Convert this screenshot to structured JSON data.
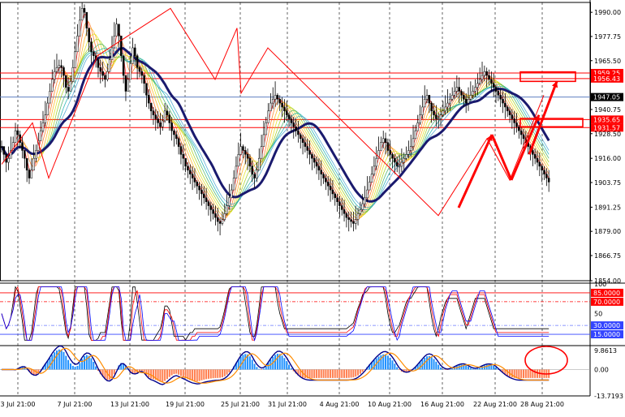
{
  "chart_data": {
    "type": "line",
    "instrument_panels": [
      {
        "panel": "price",
        "series": [
          {
            "role": "price",
            "x": [
              0,
              1,
              2,
              3,
              4,
              5,
              6,
              7,
              8,
              9,
              10,
              11,
              12,
              13,
              14,
              15,
              16,
              17,
              18,
              19,
              20,
              21,
              22,
              23,
              24,
              25,
              26,
              27,
              28,
              29,
              30,
              31,
              32,
              33,
              34,
              35,
              36,
              37,
              38,
              39,
              40,
              41,
              42,
              43,
              44,
              45,
              46,
              47,
              48,
              49,
              50,
              51,
              52,
              53,
              54,
              55,
              56,
              57,
              58,
              59,
              60,
              61,
              62,
              63,
              64,
              65,
              66,
              67,
              68,
              69,
              70,
              71,
              72,
              73,
              74,
              75,
              76,
              77,
              78,
              79,
              80,
              81,
              82,
              83,
              84,
              85,
              86,
              87,
              88,
              89,
              90,
              91,
              92,
              93,
              94,
              95,
              96,
              97,
              98,
              99,
              100,
              101,
              102,
              103,
              104,
              105,
              106,
              107,
              108,
              109,
              110,
              111,
              112,
              113,
              114,
              115,
              116,
              117,
              118,
              119,
              120,
              121,
              122,
              123,
              124,
              125,
              126,
              127,
              128,
              129,
              130,
              131,
              132,
              133,
              134,
              135,
              136,
              137,
              138,
              139,
              140,
              141,
              142,
              143,
              144,
              145,
              146,
              147,
              148,
              149,
              150,
              151,
              152,
              153,
              154,
              155,
              156,
              157,
              158,
              159,
              160,
              161,
              162,
              163,
              164,
              165,
              166,
              167,
              168,
              169,
              170,
              171,
              172,
              173,
              174,
              175,
              176,
              177,
              178,
              179,
              180,
              181,
              182,
              183,
              184,
              185,
              186,
              187,
              188,
              189,
              190,
              191,
              192,
              193,
              194,
              195,
              196,
              197,
              198,
              199,
              200,
              201,
              202,
              203,
              204,
              205,
              206,
              207,
              208,
              209,
              210,
              211,
              212,
              213,
              214,
              215,
              216,
              217,
              218,
              219,
              220,
              221,
              222,
              223,
              224,
              225,
              226,
              227,
              228,
              229,
              230,
              231,
              232,
              233,
              234,
              235,
              236,
              237,
              238,
              239
            ],
            "y": [
              1922,
              1918,
              1914,
              1916,
              1920,
              1924,
              1930,
              1928,
              1924,
              1920,
              1916,
              1910,
              1906,
              1910,
              1916,
              1920,
              1925,
              1930,
              1934,
              1938,
              1944,
              1950,
              1956,
              1960,
              1962,
              1963,
              1962,
              1958,
              1952,
              1950,
              1955,
              1962,
              1970,
              1978,
              1986,
              1992,
              1990,
              1982,
              1975,
              1970,
              1968,
              1966,
              1962,
              1960,
              1958,
              1956,
              1960,
              1966,
              1972,
              1978,
              1984,
              1978,
              1968,
              1958,
              1950,
              1956,
              1964,
              1972,
              1968,
              1962,
              1960,
              1958,
              1954,
              1948,
              1944,
              1940,
              1938,
              1936,
              1934,
              1932,
              1935,
              1940,
              1938,
              1934,
              1930,
              1928,
              1926,
              1922,
              1918,
              1916,
              1912,
              1910,
              1908,
              1906,
              1904,
              1902,
              1900,
              1898,
              1896,
              1894,
              1892,
              1890,
              1888,
              1886,
              1884,
              1883,
              1885,
              1888,
              1892,
              1896,
              1900,
              1906,
              1912,
              1918,
              1922,
              1920,
              1918,
              1916,
              1912,
              1908,
              1906,
              1910,
              1916,
              1922,
              1928,
              1934,
              1940,
              1944,
              1946,
              1948,
              1946,
              1944,
              1942,
              1940,
              1938,
              1936,
              1934,
              1932,
              1930,
              1928,
              1926,
              1924,
              1922,
              1920,
              1918,
              1916,
              1914,
              1912,
              1910,
              1908,
              1906,
              1904,
              1902,
              1900,
              1898,
              1896,
              1894,
              1892,
              1890,
              1888,
              1886,
              1885,
              1884,
              1883,
              1885,
              1888,
              1890,
              1893,
              1896,
              1900,
              1904,
              1908,
              1912,
              1916,
              1920,
              1924,
              1926,
              1924,
              1920,
              1918,
              1916,
              1914,
              1912,
              1912,
              1914,
              1916,
              1918,
              1920,
              1922,
              1926,
              1930,
              1934,
              1938,
              1942,
              1946,
              1948,
              1944,
              1940,
              1938,
              1936,
              1936,
              1938,
              1940,
              1942,
              1944,
              1946,
              1948,
              1950,
              1952,
              1950,
              1948,
              1946,
              1944,
              1946,
              1948,
              1950,
              1952,
              1954,
              1956,
              1958,
              1960,
              1958,
              1956,
              1954,
              1952,
              1950,
              1948,
              1946,
              1944,
              1942,
              1940,
              1938,
              1936,
              1934,
              1932,
              1930,
              1928,
              1926,
              1924,
              1922,
              1920,
              1918,
              1916,
              1914,
              1912,
              1910,
              1908,
              1906,
              1904
            ]
          }
        ],
        "y_tick_labels": [
          "1990.00",
          "1977.75",
          "1965.50",
          "1959.25",
          "1956.43",
          "1947.05",
          "1940.75",
          "1935.65",
          "1931.57",
          "1928.50",
          "1916.00",
          "1903.75",
          "1891.25",
          "1879.00",
          "1866.75",
          "1854.00"
        ],
        "highlighted_levels": [
          {
            "label": "1959.25",
            "value": 1959.25,
            "color": "#ff0000"
          },
          {
            "label": "1956.43",
            "value": 1956.43,
            "color": "#ff0000"
          },
          {
            "label": "1947.05",
            "value": 1947.05,
            "color": "#000000"
          },
          {
            "label": "1935.65",
            "value": 1935.65,
            "color": "#ff0000"
          },
          {
            "label": "1931.57",
            "value": 1931.57,
            "color": "#ff0000"
          }
        ],
        "ylim": [
          1854,
          1995
        ]
      },
      {
        "panel": "oscillator",
        "y_tick_labels": [
          "100",
          "85.0000",
          "70.0000",
          "50",
          "30.0000",
          "15.0000"
        ],
        "ylim": [
          0,
          100
        ]
      },
      {
        "panel": "macd",
        "y_tick_labels": [
          "9.8613",
          "0.00",
          "-13.7193"
        ],
        "ylim": [
          -13.7193,
          12
        ]
      }
    ],
    "x_tick_labels": [
      "3 Jul 21:00",
      "7 Jul 21:00",
      "13 Jul 21:00",
      "19 Jul 21:00",
      "25 Jul 21:00",
      "31 Jul 21:00",
      "4 Aug 21:00",
      "10 Aug 21:00",
      "16 Aug 21:00",
      "22 Aug 21:00",
      "28 Aug 21:00"
    ],
    "title": "",
    "xlabel": "",
    "ylabel": "",
    "grid": true
  },
  "colors": {
    "background": "#ffffff",
    "grid": "#000000",
    "price_line": "#000000",
    "ma_thick": "#1a1a6e",
    "annotation_red": "#ff0000",
    "macd_positive": "#1e90ff",
    "macd_negative": "#ff7f50",
    "macd_signal": "#ff8c00",
    "macd_line": "#00008b",
    "osc_line1": "#000000",
    "osc_line2": "#ff0000",
    "osc_line3": "#0000ff"
  }
}
